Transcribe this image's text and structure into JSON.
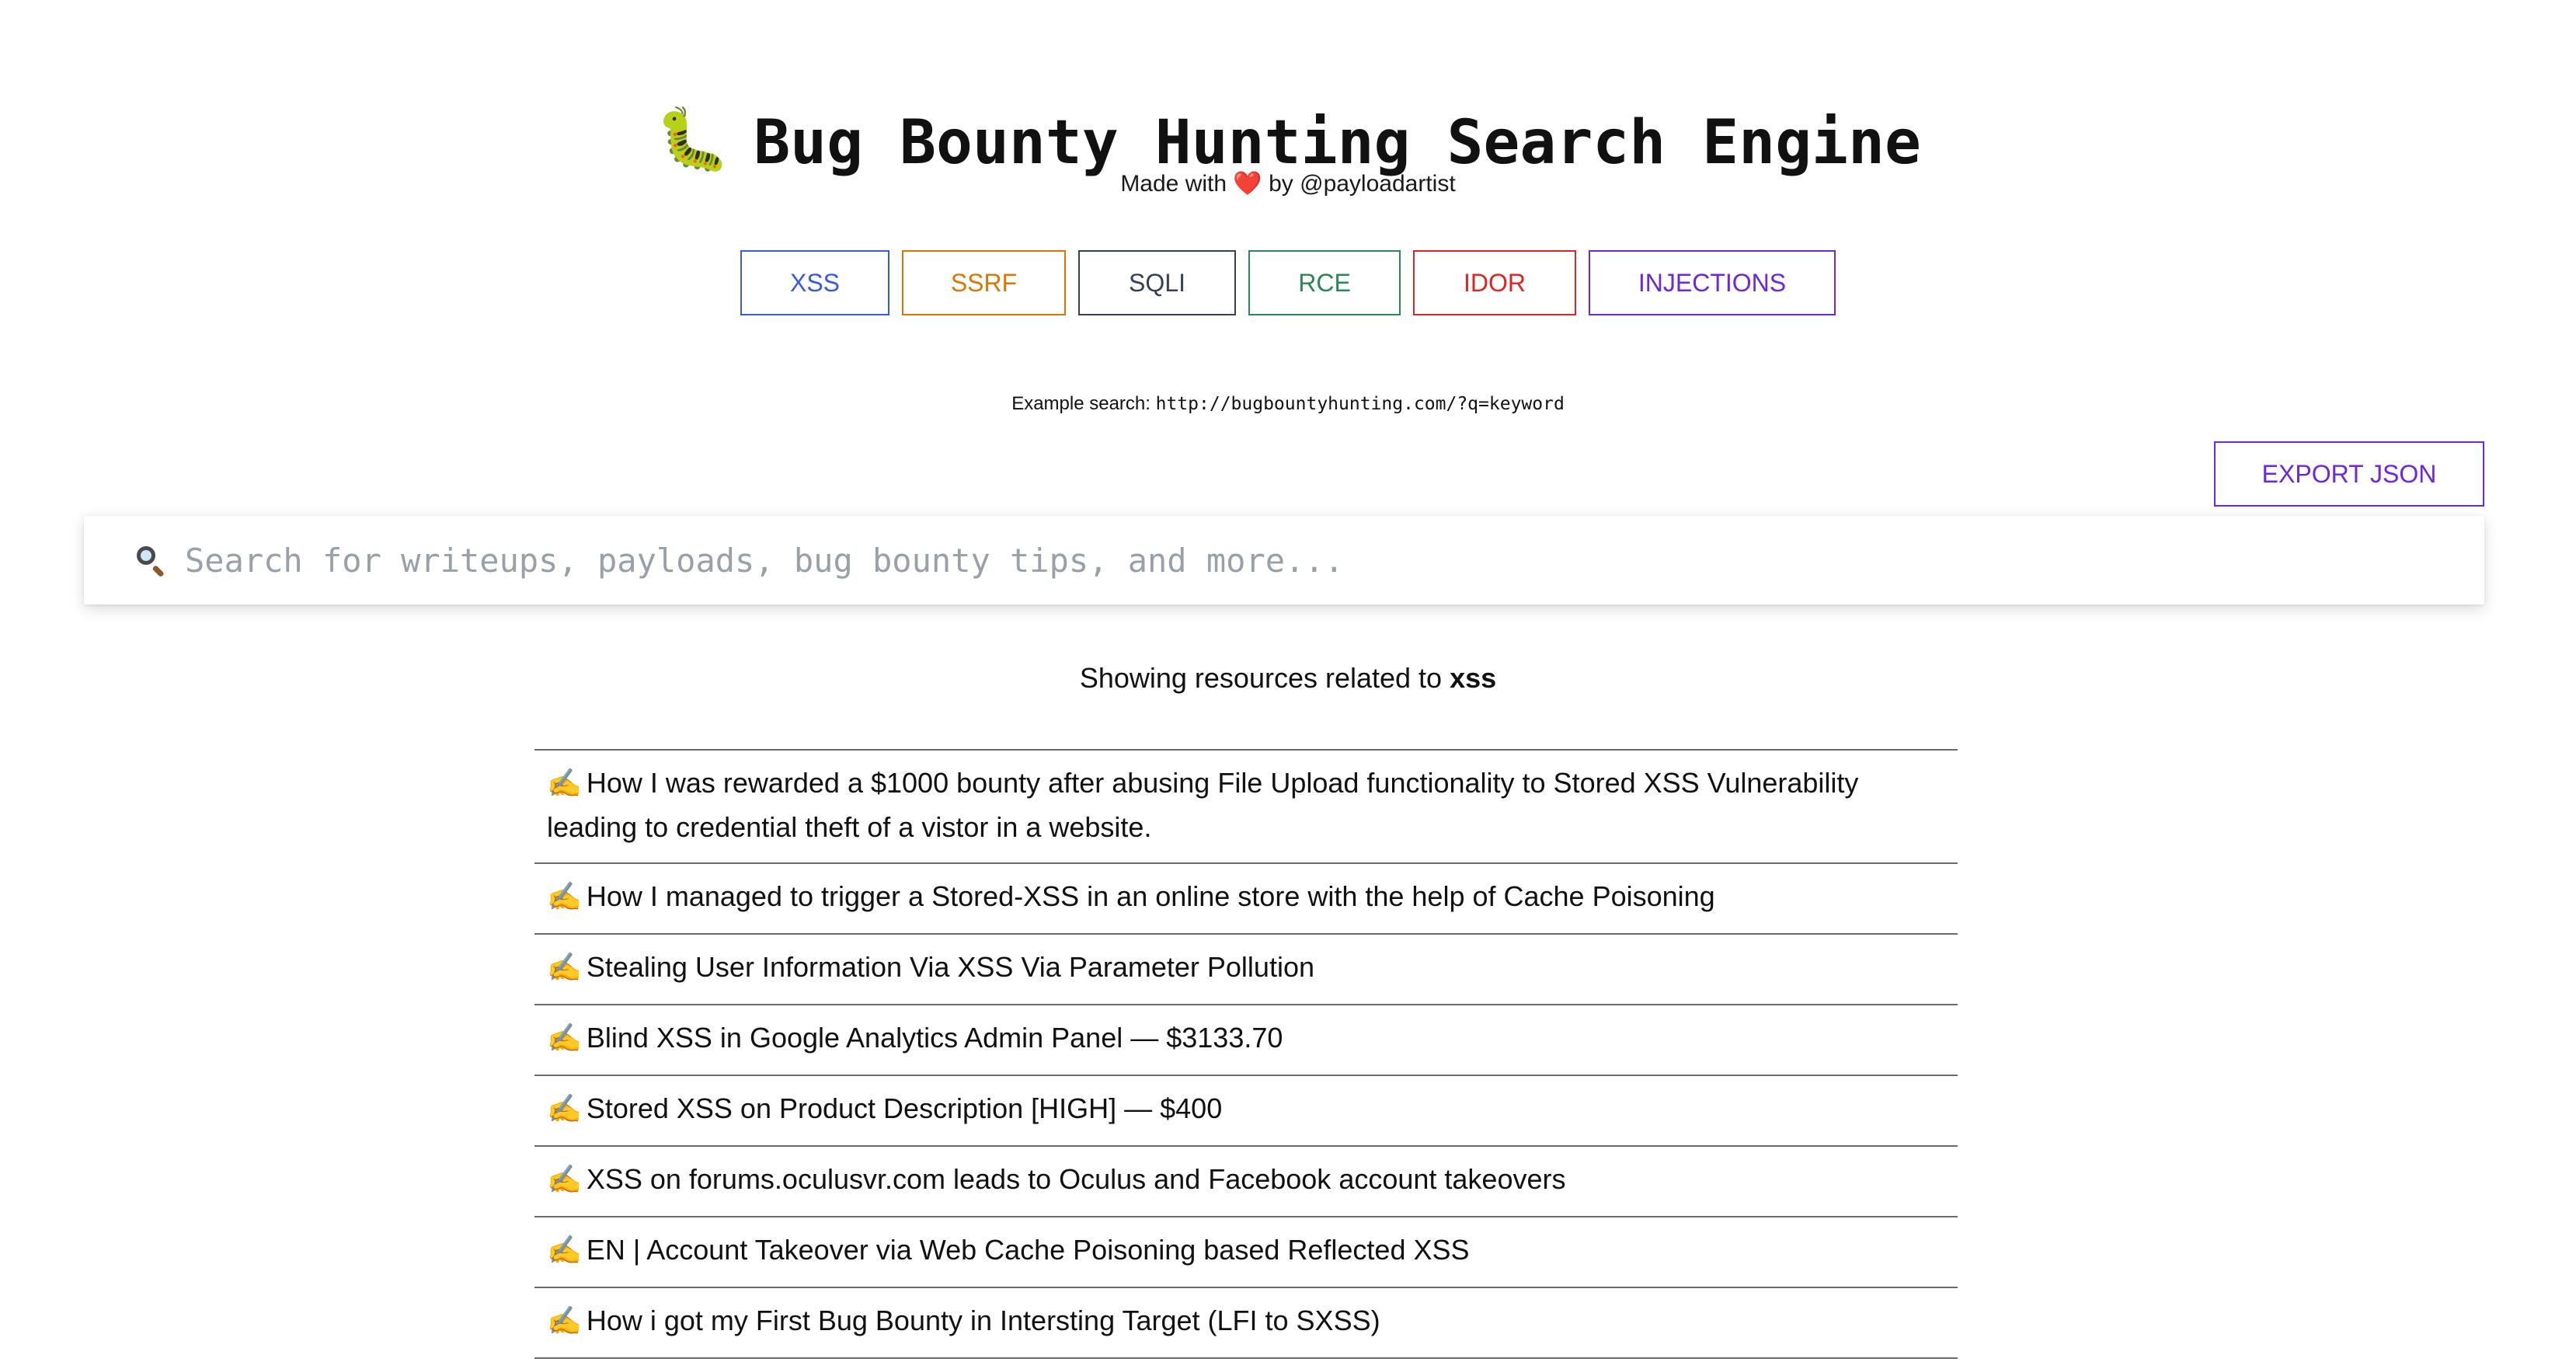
{
  "header": {
    "icon": "bug-icon",
    "icon_glyph": "🐛",
    "title": "Bug Bounty Hunting Search Engine"
  },
  "tagline": {
    "prefix": "Made with",
    "heart_glyph": "❤️",
    "suffix": "by @payloadartist"
  },
  "categories": [
    {
      "label": "XSS",
      "color": "#3b5bdb"
    },
    {
      "label": "SSRF",
      "color": "#d97706"
    },
    {
      "label": "SQLI",
      "color": "#374151"
    },
    {
      "label": "RCE",
      "color": "#2f855a"
    },
    {
      "label": "IDOR",
      "color": "#dc2626"
    },
    {
      "label": "INJECTIONS",
      "color": "#6d28d9"
    }
  ],
  "example": {
    "label": "Example search:",
    "url": "http://bugbountyhunting.com/?q=keyword"
  },
  "export": {
    "label": "EXPORT JSON",
    "color": "#6d28d9"
  },
  "search": {
    "icon": "magnifying-glass-icon",
    "placeholder": "Search for writeups, payloads, bug bounty tips, and more...",
    "value": ""
  },
  "results_heading": {
    "prefix": "Showing resources related to",
    "query": "xss"
  },
  "results": [
    {
      "icon": "writing-hand-icon",
      "title": "How I was rewarded a $1000 bounty after abusing File Upload functionality to Stored XSS Vulnerability leading to credential theft of a vistor in a website."
    },
    {
      "icon": "writing-hand-icon",
      "title": "How I managed to trigger a Stored-XSS in an online store with the help of Cache Poisoning"
    },
    {
      "icon": "writing-hand-icon",
      "title": "Stealing User Information Via XSS Via Parameter Pollution"
    },
    {
      "icon": "writing-hand-icon",
      "title": "Blind XSS in Google Analytics Admin Panel — $3133.70"
    },
    {
      "icon": "writing-hand-icon",
      "title": "Stored XSS on Product Description [HIGH] — $400"
    },
    {
      "icon": "writing-hand-icon",
      "title": "XSS on forums.oculusvr.com leads to Oculus and Facebook account takeovers"
    },
    {
      "icon": "writing-hand-icon",
      "title": "EN | Account Takeover via Web Cache Poisoning based Reflected XSS"
    },
    {
      "icon": "writing-hand-icon",
      "title": "How i got my First Bug Bounty in Intersting Target (LFI to SXSS)"
    }
  ]
}
